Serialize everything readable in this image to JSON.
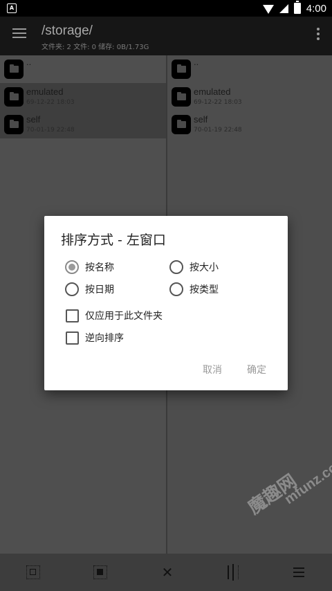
{
  "status_bar": {
    "time": "4:00",
    "notif_letter": "A"
  },
  "toolbar": {
    "path": "/storage/",
    "subtitle": "文件夹: 2  文件: 0  储存: 0B/1.73G"
  },
  "left_pane": {
    "items": [
      {
        "name": "..",
        "date": ""
      },
      {
        "name": "emulated",
        "date": "69-12-22 18:03"
      },
      {
        "name": "self",
        "date": "70-01-19 22:48"
      }
    ]
  },
  "right_pane": {
    "items": [
      {
        "name": "..",
        "date": ""
      },
      {
        "name": "emulated",
        "date": "69-12-22 18:03"
      },
      {
        "name": "self",
        "date": "70-01-19 22:48"
      }
    ]
  },
  "dialog": {
    "title": "排序方式 - 左窗口",
    "sort_options": [
      {
        "label": "按名称",
        "selected": true
      },
      {
        "label": "按大小",
        "selected": false
      },
      {
        "label": "按日期",
        "selected": false
      },
      {
        "label": "按类型",
        "selected": false
      }
    ],
    "checkboxes": [
      {
        "label": "仅应用于此文件夹",
        "checked": false
      },
      {
        "label": "逆向排序",
        "checked": false
      }
    ],
    "cancel_label": "取消",
    "ok_label": "确定"
  },
  "watermark": {
    "line1": "魔趣网",
    "line2": "mfunz.com"
  },
  "colors": {
    "dialog_bg": "#ffffff",
    "button_text": "#9a9a9a",
    "overlay_bg": "#4a4a4a"
  }
}
